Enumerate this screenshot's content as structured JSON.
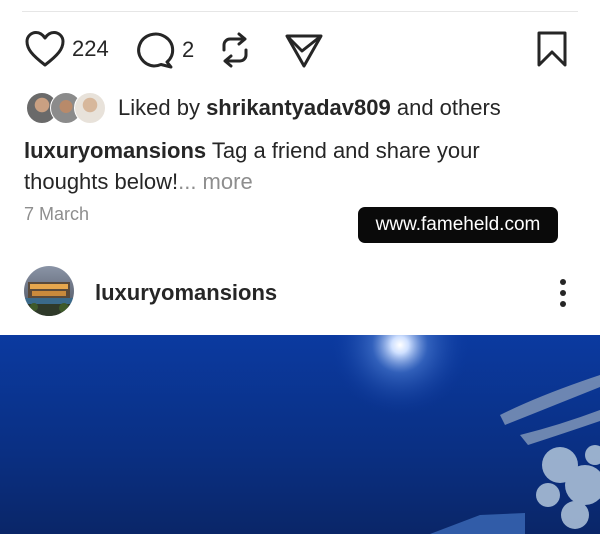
{
  "actions": {
    "like_count": "224",
    "comment_count": "2",
    "icons": [
      "heart-icon",
      "comment-icon",
      "repost-icon",
      "send-icon",
      "bookmark-icon"
    ]
  },
  "likes": {
    "prefix": "Liked by ",
    "username": "shrikantyadav809",
    "suffix": " and others"
  },
  "caption": {
    "username": "luxuryomansions",
    "text": " Tag a friend and share your thoughts below!",
    "more": "... more"
  },
  "date": "7 March",
  "watermark": "www.fameheld.com",
  "next_post": {
    "username": "luxuryomansions"
  },
  "colors": {
    "text": "#262626",
    "muted": "#8e8e8e",
    "watermark_bg": "#0a0a0a",
    "image_sky": "#0d3a8a"
  }
}
